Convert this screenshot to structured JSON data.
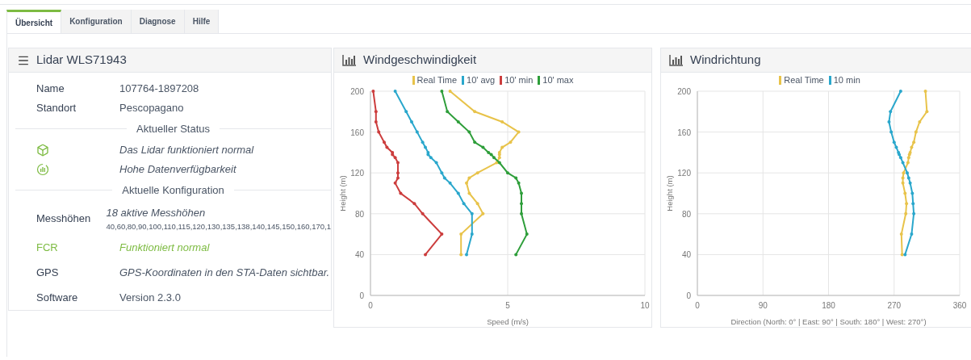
{
  "tabs": [
    {
      "label": "Übersicht",
      "selected": true
    },
    {
      "label": "Konfiguration",
      "selected": false
    },
    {
      "label": "Diagnose",
      "selected": false
    },
    {
      "label": "Hilfe",
      "selected": false
    }
  ],
  "info_panel": {
    "title": "Lidar WLS71943",
    "fields": [
      {
        "label": "Name",
        "value": "107764-1897208"
      },
      {
        "label": "Standort",
        "value": "Pescopagano"
      }
    ],
    "status_heading": "Aktueller Status",
    "status": [
      {
        "kind": "device",
        "text": "Das Lidar funktioniert normal"
      },
      {
        "kind": "data",
        "text": "Hohe Datenverfügbarkeit"
      }
    ],
    "config_heading": "Aktuelle Konfiguration",
    "config": [
      {
        "label": "Messhöhen",
        "value": "18 aktive Messhöhen",
        "detail": "40,60,80,90,100,110,115,120,130,135,138,140,145,150,160,170,1",
        "highlight": false,
        "emphasis": true
      },
      {
        "label": "FCR",
        "value": "Funktioniert normal",
        "highlight": true,
        "emphasis": true
      },
      {
        "label": "GPS",
        "value": "GPS-Koordinaten in den STA-Daten sichtbar.",
        "highlight": false,
        "emphasis": true
      },
      {
        "label": "Software",
        "value": "Version 2.3.0",
        "highlight": false,
        "emphasis": false
      }
    ]
  },
  "speed_panel": {
    "title": "Windgeschwindigkeit",
    "chart_data": {
      "type": "line",
      "xlabel": "Speed (m/s)",
      "ylabel": "Height (m)",
      "xlim": [
        0,
        10
      ],
      "ylim": [
        0,
        200
      ],
      "xticks": [
        0,
        5,
        10
      ],
      "yticks": [
        0,
        40,
        80,
        120,
        160,
        200
      ],
      "grid": true,
      "legend": "top",
      "series": [
        {
          "name": "Real Time",
          "color": "#e8c34a",
          "x": [
            3.3,
            3.3,
            4.1,
            3.9,
            3.6,
            3.5,
            3.6,
            3.9,
            4.6,
            4.7,
            4.7,
            4.7,
            4.8,
            5.1,
            5.4,
            4.8,
            3.8,
            2.9
          ],
          "values": [
            40,
            60,
            80,
            90,
            100,
            110,
            115,
            120,
            130,
            135,
            138,
            140,
            145,
            150,
            160,
            170,
            180,
            200
          ]
        },
        {
          "name": "10' avg",
          "color": "#2aa7cc",
          "x": [
            3.5,
            3.7,
            3.7,
            3.4,
            3.2,
            2.9,
            2.7,
            2.6,
            2.4,
            2.2,
            2.1,
            2.1,
            2.0,
            1.9,
            1.7,
            1.5,
            1.3,
            0.9
          ],
          "values": [
            40,
            60,
            80,
            90,
            100,
            110,
            115,
            120,
            130,
            135,
            138,
            140,
            145,
            150,
            160,
            170,
            180,
            200
          ]
        },
        {
          "name": "10' min",
          "color": "#cc3d3d",
          "x": [
            2.0,
            2.6,
            1.9,
            1.6,
            1.1,
            0.9,
            1.0,
            1.0,
            1.0,
            0.9,
            0.8,
            0.8,
            0.6,
            0.5,
            0.3,
            0.2,
            0.2,
            0.1
          ],
          "values": [
            40,
            60,
            80,
            90,
            100,
            110,
            115,
            120,
            130,
            135,
            138,
            140,
            145,
            150,
            160,
            170,
            180,
            200
          ]
        },
        {
          "name": "10' max",
          "color": "#2e9e3a",
          "x": [
            5.3,
            5.7,
            5.5,
            5.5,
            5.5,
            5.4,
            5.3,
            5.0,
            4.7,
            4.5,
            4.4,
            4.3,
            4.1,
            3.8,
            3.6,
            3.2,
            2.8,
            2.6
          ],
          "values": [
            40,
            60,
            80,
            90,
            100,
            110,
            115,
            120,
            130,
            135,
            138,
            140,
            145,
            150,
            160,
            170,
            180,
            200
          ]
        }
      ]
    }
  },
  "direction_panel": {
    "title": "Windrichtung",
    "chart_data": {
      "type": "line",
      "xlabel": "Direction (North: 0° | East:  90°  |  South: 180°  |  West: 270°)",
      "ylabel": "Height (m)",
      "xlim": [
        0,
        360
      ],
      "ylim": [
        0,
        200
      ],
      "xticks": [
        0,
        90,
        180,
        270,
        360
      ],
      "yticks": [
        0,
        40,
        80,
        120,
        160,
        200
      ],
      "grid": true,
      "legend": "top",
      "series": [
        {
          "name": "Real Time",
          "color": "#e8c34a",
          "x": [
            281,
            280,
            286,
            287,
            285,
            282,
            282,
            283,
            289,
            290,
            291,
            292,
            294,
            297,
            300,
            305,
            315,
            313
          ],
          "values": [
            40,
            60,
            80,
            90,
            100,
            110,
            115,
            120,
            130,
            135,
            138,
            140,
            145,
            150,
            160,
            170,
            180,
            200
          ]
        },
        {
          "name": "10 min",
          "color": "#2aa7cc",
          "x": [
            285,
            294,
            297,
            296,
            295,
            292,
            290,
            288,
            282,
            279,
            277,
            276,
            273,
            270,
            266,
            263,
            265,
            279
          ],
          "values": [
            40,
            60,
            80,
            90,
            100,
            110,
            115,
            120,
            130,
            135,
            138,
            140,
            145,
            150,
            160,
            170,
            180,
            200
          ]
        }
      ]
    }
  }
}
